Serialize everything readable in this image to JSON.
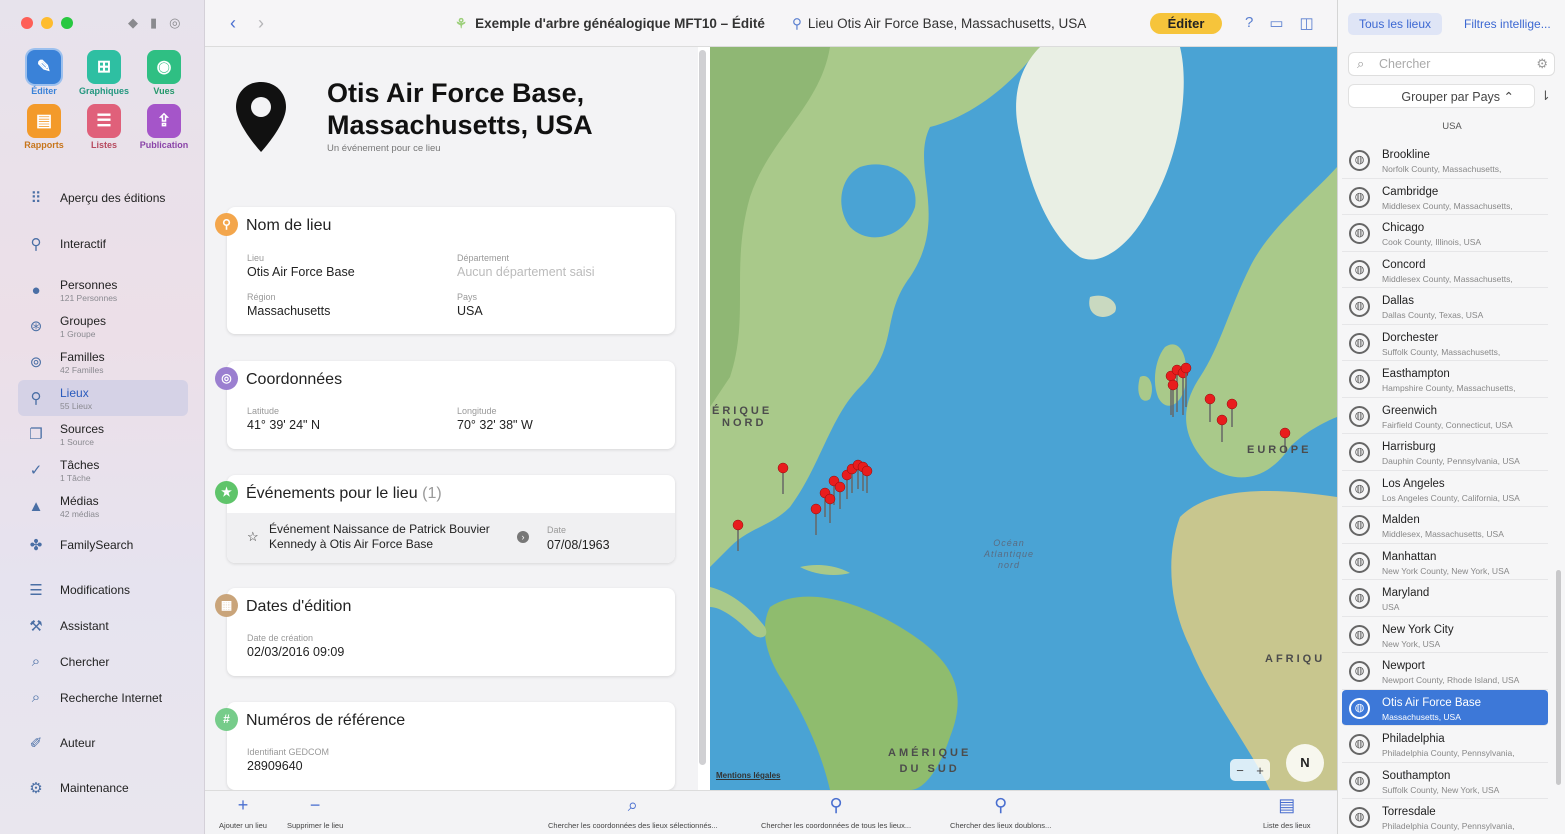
{
  "window": {
    "document_title": "Exemple d'arbre généalogique MFT10 – Édité",
    "location_title": "Lieu Otis Air Force Base, Massachusetts, USA",
    "edit_button": "Éditer"
  },
  "toolbar_tools": [
    {
      "label": "Éditer",
      "icon": "pencil-icon",
      "color": "#3a82d8"
    },
    {
      "label": "Graphiques",
      "icon": "chart-icon",
      "color": "#2ebfa2"
    },
    {
      "label": "Vues",
      "icon": "eye-icon",
      "color": "#2fbf83"
    },
    {
      "label": "Rapports",
      "icon": "report-icon",
      "color": "#f39a2a"
    },
    {
      "label": "Listes",
      "icon": "list-icon",
      "color": "#e0607a"
    },
    {
      "label": "Publication",
      "icon": "share-icon",
      "color": "#a555c9"
    }
  ],
  "sidebar": {
    "items": [
      {
        "label": "Aperçu des éditions",
        "sub": "",
        "icon": "grid-icon"
      },
      {
        "label": "Interactif",
        "sub": "",
        "icon": "tree-icon"
      },
      {
        "label": "Personnes",
        "sub": "121 Personnes",
        "icon": "person-icon"
      },
      {
        "label": "Groupes",
        "sub": "1 Groupe",
        "icon": "group-icon"
      },
      {
        "label": "Familles",
        "sub": "42 Familles",
        "icon": "rings-icon"
      },
      {
        "label": "Lieux",
        "sub": "55 Lieux",
        "icon": "pin-icon"
      },
      {
        "label": "Sources",
        "sub": "1 Source",
        "icon": "sources-icon"
      },
      {
        "label": "Tâches",
        "sub": "1 Tâche",
        "icon": "check-icon"
      },
      {
        "label": "Médias",
        "sub": "42 médias",
        "icon": "media-icon"
      },
      {
        "label": "FamilySearch",
        "sub": "",
        "icon": "familysearch-icon"
      },
      {
        "label": "Modifications",
        "sub": "",
        "icon": "changes-icon"
      },
      {
        "label": "Assistant",
        "sub": "",
        "icon": "assistant-icon"
      },
      {
        "label": "Chercher",
        "sub": "",
        "icon": "search-icon"
      },
      {
        "label": "Recherche Internet",
        "sub": "",
        "icon": "web-search-icon"
      },
      {
        "label": "Auteur",
        "sub": "",
        "icon": "author-icon"
      },
      {
        "label": "Maintenance",
        "sub": "",
        "icon": "maintenance-icon"
      }
    ]
  },
  "place": {
    "title": "Otis Air Force Base, Massachusetts, USA",
    "subtitle": "Un événement pour ce lieu"
  },
  "cards": {
    "name": {
      "title": "Nom de lieu",
      "lieu_label": "Lieu",
      "lieu_value": "Otis Air Force Base",
      "dept_label": "Département",
      "dept_value": "Aucun département saisi",
      "region_label": "Région",
      "region_value": "Massachusetts",
      "pays_label": "Pays",
      "pays_value": "USA"
    },
    "coords": {
      "title": "Coordonnées",
      "lat_label": "Latitude",
      "lat_value": "41° 39' 24\" N",
      "lon_label": "Longitude",
      "lon_value": "70° 32' 38\" W"
    },
    "events": {
      "title": "Événements pour le lieu",
      "count": "(1)",
      "event_text": "Événement Naissance de Patrick Bouvier Kennedy à Otis Air Force Base",
      "date_label": "Date",
      "date_value": "07/08/1963"
    },
    "dates": {
      "title": "Dates d'édition",
      "created_label": "Date de création",
      "created_value": "02/03/2016 09:09"
    },
    "refs": {
      "title": "Numéros de référence",
      "gedcom_label": "Identifiant GEDCOM",
      "gedcom_value": "28909640"
    }
  },
  "map": {
    "labels": {
      "na_1": "ÉRIQUE",
      "na_2": "NORD",
      "europe": "EUROPE",
      "afrique": "AFRIQU",
      "sa_1": "AMÉRIQUE",
      "sa_2": "DU SUD",
      "ocean": "Océan Atlantique nord"
    },
    "legal": "Mentions légales",
    "zoom_out": "−",
    "zoom_in": "+",
    "compass": "N"
  },
  "bottom_toolbar": [
    {
      "label": "Ajouter un lieu",
      "icon": "plus-icon"
    },
    {
      "label": "Supprimer le lieu",
      "icon": "minus-icon"
    },
    {
      "label": "Chercher les coordonnées des lieux sélectionnés...",
      "icon": "search-icon"
    },
    {
      "label": "Chercher les coordonnées de tous les lieux...",
      "icon": "pin-search-icon"
    },
    {
      "label": "Chercher des lieux doublons...",
      "icon": "duplicate-pin-icon"
    },
    {
      "label": "Liste des lieux",
      "icon": "list-icon"
    }
  ],
  "right_panel": {
    "tab_all": "Tous les lieux",
    "tab_smart": "Filtres intellige...",
    "search_placeholder": "Chercher",
    "group_by": "Grouper par Pays ⌃",
    "section": "USA",
    "places": [
      {
        "name": "Brookline",
        "detail": "Norfolk County, Massachusetts,"
      },
      {
        "name": "Cambridge",
        "detail": "Middlesex County, Massachusetts,"
      },
      {
        "name": "Chicago",
        "detail": "Cook County, Illinois, USA"
      },
      {
        "name": "Concord",
        "detail": "Middlesex County, Massachusetts,"
      },
      {
        "name": "Dallas",
        "detail": "Dallas County, Texas, USA"
      },
      {
        "name": "Dorchester",
        "detail": "Suffolk County, Massachusetts,"
      },
      {
        "name": "Easthampton",
        "detail": "Hampshire County, Massachusetts,"
      },
      {
        "name": "Greenwich",
        "detail": "Fairfield County, Connecticut, USA"
      },
      {
        "name": "Harrisburg",
        "detail": "Dauphin County, Pennsylvania, USA"
      },
      {
        "name": "Los Angeles",
        "detail": "Los Angeles County, California, USA"
      },
      {
        "name": "Malden",
        "detail": "Middlesex, Massachusetts, USA"
      },
      {
        "name": "Manhattan",
        "detail": "New York County, New York, USA"
      },
      {
        "name": "Maryland",
        "detail": "USA"
      },
      {
        "name": "New York City",
        "detail": "New York, USA"
      },
      {
        "name": "Newport",
        "detail": "Newport County, Rhode Island, USA"
      },
      {
        "name": "Otis Air Force Base",
        "detail": "Massachusetts, USA"
      },
      {
        "name": "Philadelphia",
        "detail": "Philadelphia County, Pennsylvania,"
      },
      {
        "name": "Southampton",
        "detail": "Suffolk County, New York, USA"
      },
      {
        "name": "Torresdale",
        "detail": "Philadelphia County, Pennsylvania,"
      }
    ]
  }
}
